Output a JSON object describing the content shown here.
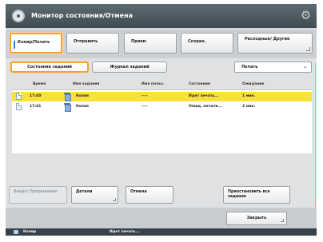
{
  "title": "Монитор состояния/Отмена",
  "tabs": [
    {
      "label": "Копир/Печать"
    },
    {
      "label": "Отправить"
    },
    {
      "label": "Прием"
    },
    {
      "label": "Сохран."
    },
    {
      "label": "Расходные/ Другие"
    }
  ],
  "subtabs": {
    "status": "Состояние заданий",
    "log": "Журнал заданий"
  },
  "filter": {
    "selected": "Печать"
  },
  "table": {
    "headers": [
      "Время",
      "Имя задания",
      "Имя польз.",
      "Состояние",
      "Ожидание"
    ],
    "rows": [
      {
        "time": "17:40",
        "name": "Копия",
        "user": "----",
        "status": "Идет печать...",
        "wait": "1 мин."
      },
      {
        "time": "17:41",
        "name": "Копия",
        "user": "----",
        "status": "Ожид. печати...",
        "wait": "2 мин."
      }
    ]
  },
  "actions": {
    "move_up": "Вверх/ Прерывание",
    "details": "Детали",
    "cancel": "Отмена",
    "pause": "Приостановить все задания"
  },
  "footer": {
    "close": "Закрыть"
  },
  "statusbar": {
    "left": "Копир",
    "message": "Идет печать..."
  }
}
